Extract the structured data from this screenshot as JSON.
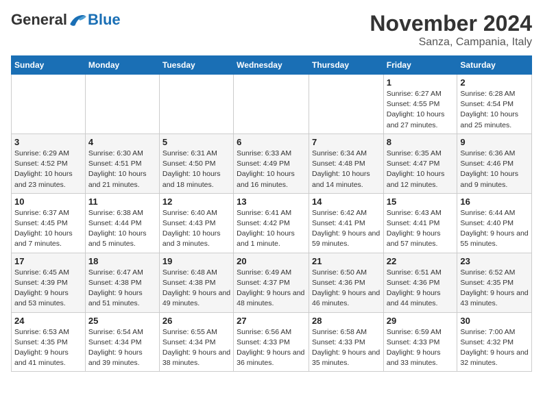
{
  "logo": {
    "general": "General",
    "blue": "Blue"
  },
  "title": "November 2024",
  "subtitle": "Sanza, Campania, Italy",
  "days_of_week": [
    "Sunday",
    "Monday",
    "Tuesday",
    "Wednesday",
    "Thursday",
    "Friday",
    "Saturday"
  ],
  "weeks": [
    [
      {
        "day": "",
        "info": ""
      },
      {
        "day": "",
        "info": ""
      },
      {
        "day": "",
        "info": ""
      },
      {
        "day": "",
        "info": ""
      },
      {
        "day": "",
        "info": ""
      },
      {
        "day": "1",
        "info": "Sunrise: 6:27 AM\nSunset: 4:55 PM\nDaylight: 10 hours and 27 minutes."
      },
      {
        "day": "2",
        "info": "Sunrise: 6:28 AM\nSunset: 4:54 PM\nDaylight: 10 hours and 25 minutes."
      }
    ],
    [
      {
        "day": "3",
        "info": "Sunrise: 6:29 AM\nSunset: 4:52 PM\nDaylight: 10 hours and 23 minutes."
      },
      {
        "day": "4",
        "info": "Sunrise: 6:30 AM\nSunset: 4:51 PM\nDaylight: 10 hours and 21 minutes."
      },
      {
        "day": "5",
        "info": "Sunrise: 6:31 AM\nSunset: 4:50 PM\nDaylight: 10 hours and 18 minutes."
      },
      {
        "day": "6",
        "info": "Sunrise: 6:33 AM\nSunset: 4:49 PM\nDaylight: 10 hours and 16 minutes."
      },
      {
        "day": "7",
        "info": "Sunrise: 6:34 AM\nSunset: 4:48 PM\nDaylight: 10 hours and 14 minutes."
      },
      {
        "day": "8",
        "info": "Sunrise: 6:35 AM\nSunset: 4:47 PM\nDaylight: 10 hours and 12 minutes."
      },
      {
        "day": "9",
        "info": "Sunrise: 6:36 AM\nSunset: 4:46 PM\nDaylight: 10 hours and 9 minutes."
      }
    ],
    [
      {
        "day": "10",
        "info": "Sunrise: 6:37 AM\nSunset: 4:45 PM\nDaylight: 10 hours and 7 minutes."
      },
      {
        "day": "11",
        "info": "Sunrise: 6:38 AM\nSunset: 4:44 PM\nDaylight: 10 hours and 5 minutes."
      },
      {
        "day": "12",
        "info": "Sunrise: 6:40 AM\nSunset: 4:43 PM\nDaylight: 10 hours and 3 minutes."
      },
      {
        "day": "13",
        "info": "Sunrise: 6:41 AM\nSunset: 4:42 PM\nDaylight: 10 hours and 1 minute."
      },
      {
        "day": "14",
        "info": "Sunrise: 6:42 AM\nSunset: 4:41 PM\nDaylight: 9 hours and 59 minutes."
      },
      {
        "day": "15",
        "info": "Sunrise: 6:43 AM\nSunset: 4:41 PM\nDaylight: 9 hours and 57 minutes."
      },
      {
        "day": "16",
        "info": "Sunrise: 6:44 AM\nSunset: 4:40 PM\nDaylight: 9 hours and 55 minutes."
      }
    ],
    [
      {
        "day": "17",
        "info": "Sunrise: 6:45 AM\nSunset: 4:39 PM\nDaylight: 9 hours and 53 minutes."
      },
      {
        "day": "18",
        "info": "Sunrise: 6:47 AM\nSunset: 4:38 PM\nDaylight: 9 hours and 51 minutes."
      },
      {
        "day": "19",
        "info": "Sunrise: 6:48 AM\nSunset: 4:38 PM\nDaylight: 9 hours and 49 minutes."
      },
      {
        "day": "20",
        "info": "Sunrise: 6:49 AM\nSunset: 4:37 PM\nDaylight: 9 hours and 48 minutes."
      },
      {
        "day": "21",
        "info": "Sunrise: 6:50 AM\nSunset: 4:36 PM\nDaylight: 9 hours and 46 minutes."
      },
      {
        "day": "22",
        "info": "Sunrise: 6:51 AM\nSunset: 4:36 PM\nDaylight: 9 hours and 44 minutes."
      },
      {
        "day": "23",
        "info": "Sunrise: 6:52 AM\nSunset: 4:35 PM\nDaylight: 9 hours and 43 minutes."
      }
    ],
    [
      {
        "day": "24",
        "info": "Sunrise: 6:53 AM\nSunset: 4:35 PM\nDaylight: 9 hours and 41 minutes."
      },
      {
        "day": "25",
        "info": "Sunrise: 6:54 AM\nSunset: 4:34 PM\nDaylight: 9 hours and 39 minutes."
      },
      {
        "day": "26",
        "info": "Sunrise: 6:55 AM\nSunset: 4:34 PM\nDaylight: 9 hours and 38 minutes."
      },
      {
        "day": "27",
        "info": "Sunrise: 6:56 AM\nSunset: 4:33 PM\nDaylight: 9 hours and 36 minutes."
      },
      {
        "day": "28",
        "info": "Sunrise: 6:58 AM\nSunset: 4:33 PM\nDaylight: 9 hours and 35 minutes."
      },
      {
        "day": "29",
        "info": "Sunrise: 6:59 AM\nSunset: 4:33 PM\nDaylight: 9 hours and 33 minutes."
      },
      {
        "day": "30",
        "info": "Sunrise: 7:00 AM\nSunset: 4:32 PM\nDaylight: 9 hours and 32 minutes."
      }
    ]
  ]
}
